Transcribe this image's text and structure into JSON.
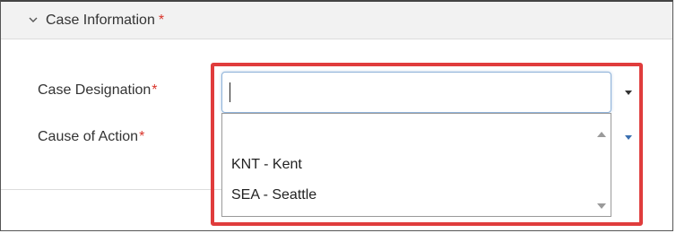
{
  "section": {
    "title": "Case Information",
    "required_mark": "*"
  },
  "fields": [
    {
      "label": "Case Designation",
      "required_mark": "*",
      "value": ""
    },
    {
      "label": "Cause of Action",
      "required_mark": "*"
    }
  ],
  "dropdown": {
    "options": [
      "",
      "KNT - Kent",
      "SEA - Seattle"
    ]
  },
  "colors": {
    "required": "#d9342b",
    "highlight": "#e03c3c",
    "focus_border": "#8fb3d9",
    "header_bg": "#f2f2f2"
  },
  "icons": {
    "section_toggle": "chevron-down-icon",
    "dropdown_arrow": "caret-down-icon"
  }
}
